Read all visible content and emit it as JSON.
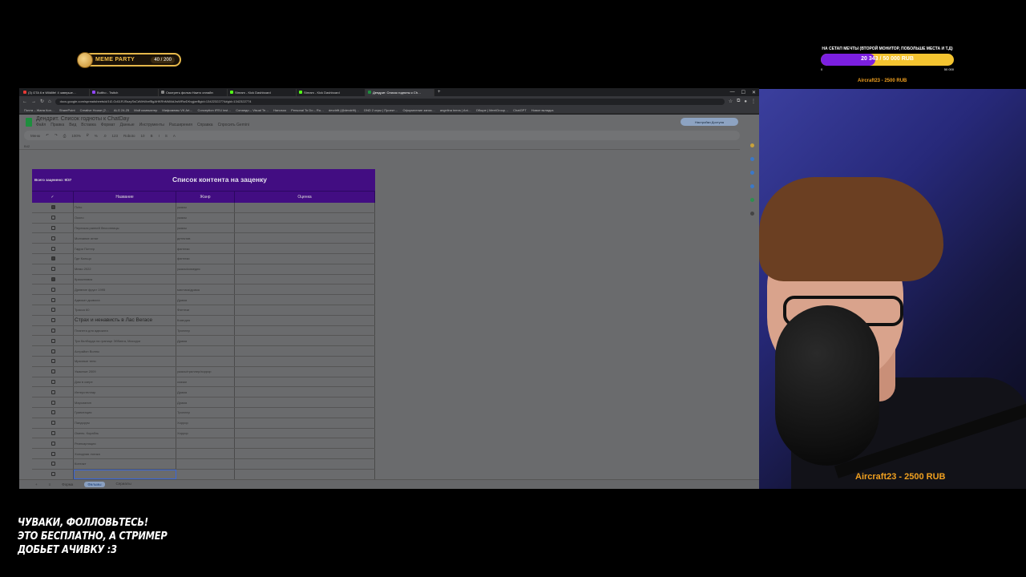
{
  "overlay": {
    "meme_label": "MEME PARTY",
    "meme_count": "40 / 200",
    "goal_title": "НА СЕТАП МЕЧТЫ (ВТОРОЙ МОНИТОР, ПОБОЛЬШЕ МЕСТА И Т.Д)",
    "goal_amount": "20 343 / 50 000 RUB",
    "goal_progress": 0.41,
    "goal_min": "0",
    "goal_max": "50 000",
    "donor_top": "Aircraft23 - 2500 RUB",
    "donor_cam": "Aircraft23 - 2500 RUB",
    "follow_lines": [
      "ЧУВАКИ, ФОЛЛОВЬТЕСЬ!",
      "ЭТО БЕСПЛАТНО, А СТРИМЕР",
      "ДОБЬЕТ АЧИВКУ :3"
    ],
    "colors": {
      "goal_fill": "#7b1fe0",
      "goal_bg": "#f4c430",
      "donor": "#f0a020"
    }
  },
  "browser": {
    "tabs": [
      {
        "label": "(3) GTA 6 в Wildlife! 4 заверше…",
        "color": "#e53935"
      },
      {
        "label": "Buttho - Twitch",
        "color": "#9146ff"
      },
      {
        "label": "Смотреть фильм Наито онлайн",
        "color": "#888888"
      },
      {
        "label": "Stream - Kick Dashboard",
        "color": "#53fc18"
      },
      {
        "label": "Stream - Kick Dashboard",
        "color": "#53fc18"
      },
      {
        "label": "Дендрит. Список годноты к Ch…",
        "color": "#1e8e3e"
      }
    ],
    "new_tab": "+",
    "url": "docs.google.com/spreadsheets/d/1t2-Gd11RJSszySsCdWrWvrfBgAHKRhNMl4dJwWRwDKvgjzeBgid=13422322774#gid=1342322774",
    "bookmarks": [
      "Почта – Жана Кон…",
      "SharePoint",
      "Creative House (2…",
      "ALG 24-25",
      "Мой компьютер",
      "Мифомемы VK Art…",
      "Conception IFEU inst…",
      "Сонанди – Visual Te…",
      "Нanosoo",
      "Personal To Do – Ru…",
      "devdrift (@devdrift)…",
      "DND 2 игры | Проект…",
      "Оформление запис…",
      "angelina teens | Ani…",
      "Общие | MeetGroup…",
      "ChatGPT",
      "Новое вкладка"
    ]
  },
  "sheet": {
    "doc_title": "Дендрит. Список годноты к ChatDay",
    "menu": [
      "Файл",
      "Правка",
      "Вид",
      "Вставка",
      "Формат",
      "Данные",
      "Инструменты",
      "Расширения",
      "Справка",
      "Спросить Gemini"
    ],
    "share_label": "Настройки Доступа",
    "toolbar": [
      "Меню",
      "↶",
      "↷",
      "⎙",
      "100%",
      "₽",
      "%",
      ".0",
      "123",
      "Roboto",
      "10",
      "B",
      "I",
      "S",
      "A"
    ],
    "cell_ref": "B42",
    "total_label": "Всего заценено: 9/37",
    "table_title": "Список контента на заценку",
    "col_check": "✓",
    "col_name": "Название",
    "col_genre": "Жанр",
    "col_rating": "Оценка",
    "rows": [
      {
        "n": "15",
        "checked": true,
        "name": "Пchо",
        "genre": "ужасы"
      },
      {
        "n": "16",
        "checked": false,
        "name": "Околo",
        "genre": "ужасы"
      },
      {
        "n": "17",
        "checked": false,
        "name": "Пересказ ранней бессонницы",
        "genre": "ужасы"
      },
      {
        "n": "18",
        "checked": false,
        "name": "Молчание ягнят",
        "genre": "детектив"
      },
      {
        "n": "19",
        "checked": false,
        "name": "Гарри Поттер",
        "genre": "фэнтези"
      },
      {
        "n": "20",
        "checked": true,
        "name": "Где Кольцо",
        "genre": "фэнтези"
      },
      {
        "n": "21",
        "checked": false,
        "name": "Мемо 2022",
        "genre": "ужасы/комедия"
      },
      {
        "n": "22",
        "checked": true,
        "name": "Краоклювик",
        "genre": ""
      },
      {
        "n": "23",
        "checked": false,
        "name": "Древние фрукт 1995",
        "genre": "мистика/драма"
      },
      {
        "n": "24",
        "checked": false,
        "name": "Адвокат дьявола",
        "genre": "Драма"
      },
      {
        "n": "25",
        "checked": false,
        "name": "Трасса 60",
        "genre": "Фэнтези"
      },
      {
        "n": "26",
        "checked": false,
        "name": "Страх и ненависть в Лас Вегасе",
        "genre": "Комедия",
        "big": true
      },
      {
        "n": "27",
        "checked": false,
        "name": "Планетa для адвоката",
        "genre": "Триллер"
      },
      {
        "n": "28",
        "checked": false,
        "name": "Три билборда на границе Эббинга, Миссури",
        "genre": "Драма"
      },
      {
        "n": "29",
        "checked": false,
        "name": "Астрайон Волны",
        "genre": ""
      },
      {
        "n": "30",
        "checked": false,
        "name": "Мрачные тени",
        "genre": ""
      },
      {
        "n": "31",
        "checked": false,
        "name": "Ужасные 2009",
        "genre": "ужасы/триллер/хоррор"
      },
      {
        "n": "32",
        "checked": false,
        "name": "Дом в озере",
        "genre": "сказки"
      },
      {
        "n": "33",
        "checked": false,
        "name": "Интерстеллар",
        "genre": "Драма"
      },
      {
        "n": "34",
        "checked": false,
        "name": "Марсианин",
        "genre": "Драма"
      },
      {
        "n": "35",
        "checked": false,
        "name": "Гравитация",
        "genre": "Триллер"
      },
      {
        "n": "36",
        "checked": false,
        "name": "Пандорум",
        "genre": "Хоррор"
      },
      {
        "n": "37",
        "checked": false,
        "name": "Омень: Корабль",
        "genre": "Хоррор"
      },
      {
        "n": "38",
        "checked": false,
        "name": "Реинкарнация",
        "genre": ""
      },
      {
        "n": "39",
        "checked": false,
        "name": "Холодная логика",
        "genre": ""
      },
      {
        "n": "40",
        "checked": false,
        "name": "Контакт",
        "genre": ""
      },
      {
        "n": "41",
        "checked": false,
        "name": "",
        "genre": "",
        "sel": true
      },
      {
        "n": "42",
        "checked": false,
        "name": "",
        "genre": ""
      },
      {
        "n": "43",
        "checked": false,
        "name": "",
        "genre": ""
      }
    ],
    "sheet_tabs": [
      "Фильмы",
      "Сериалы"
    ],
    "sheet_tab_first": "Форма",
    "active_sheet": "Фильмы"
  }
}
